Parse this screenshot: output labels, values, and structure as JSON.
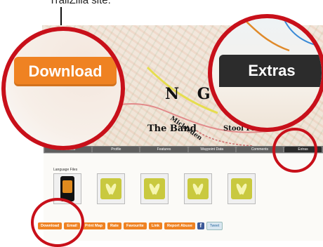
{
  "caption": {
    "text": "TrailZilla site:"
  },
  "map": {
    "labels": {
      "ngdal": "N G D A L",
      "mickleden": "Mickleden",
      "band": "The Band",
      "stool": "Stool Fel"
    }
  },
  "tabs": [
    {
      "label": "Overview"
    },
    {
      "label": "Profile"
    },
    {
      "label": "Features"
    },
    {
      "label": "Waypoint Data"
    },
    {
      "label": "Comments"
    },
    {
      "label": "Extras",
      "active": true
    }
  ],
  "extras_panel": {
    "language_label": "Language Files",
    "thumbnails": [
      {
        "icon": "phone-app-icon"
      },
      {
        "icon": "leaf-logo-icon"
      },
      {
        "icon": "leaf-logo-icon"
      },
      {
        "icon": "leaf-logo-icon"
      },
      {
        "icon": "leaf-logo-icon"
      },
      {
        "icon": "leaf-logo-icon"
      }
    ]
  },
  "actions": [
    "Download",
    "Email",
    "Print Map",
    "Rate",
    "Favourite",
    "Link",
    "Report Abuse"
  ],
  "social": {
    "facebook": "f",
    "tweet": "Tweet"
  },
  "zoom": {
    "download_label": "Download",
    "extras_label": "Extras"
  },
  "colors": {
    "accent_orange": "#ef8222",
    "highlight_red": "#c8101a",
    "tab_dark": "#2c2c2c"
  }
}
